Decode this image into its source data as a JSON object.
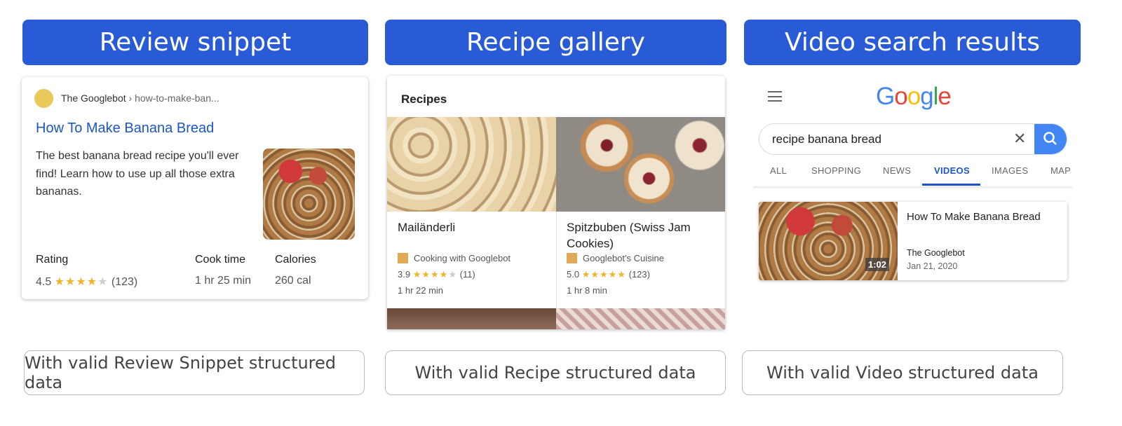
{
  "headers": [
    "Review snippet",
    "Recipe gallery",
    "Video search results"
  ],
  "captions": [
    "With valid Review Snippet structured data",
    "With valid Recipe structured data",
    "With valid Video structured data"
  ],
  "review": {
    "site": "The Googlebot",
    "path": "› how-to-make-ban...",
    "title": "How To Make Banana Bread",
    "description": "The best banana bread recipe you'll ever find! Learn how to use up all those extra bananas.",
    "rating_label": "Rating",
    "rating": "4.5",
    "rating_stars": 4.5,
    "rating_count": "(123)",
    "cook_label": "Cook time",
    "cook_time": "1 hr 25 min",
    "cal_label": "Calories",
    "calories": "260 cal",
    "favicon_color": "#e8c95a"
  },
  "gallery": {
    "heading": "Recipes",
    "items": [
      {
        "title": "Mailänderli",
        "source": "Cooking with Googlebot",
        "rating": "3.9",
        "stars": 3.9,
        "count": "(11)",
        "time": "1 hr 22 min"
      },
      {
        "title": "Spitzbuben (Swiss Jam Cookies)",
        "source": "Googlebot's Cuisine",
        "rating": "5.0",
        "stars": 5,
        "count": "(123)",
        "time": "1 hr 8 min"
      }
    ]
  },
  "video": {
    "logo": "Google",
    "query": "recipe banana bread",
    "tabs": [
      "ALL",
      "SHOPPING",
      "NEWS",
      "VIDEOS",
      "IMAGES",
      "MAPS"
    ],
    "active_tab": "VIDEOS",
    "result": {
      "title": "How To Make Banana Bread",
      "channel": "The Googlebot",
      "date": "Jan 21, 2020",
      "duration": "1:02"
    }
  },
  "colors": {
    "header": "#2a5bd7",
    "link": "#1a56c8",
    "star": "#f0b429",
    "google_blue": "#4285f4"
  }
}
